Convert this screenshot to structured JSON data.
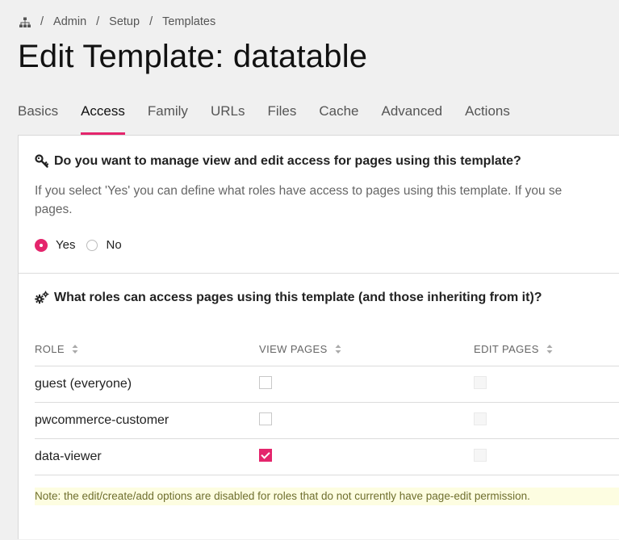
{
  "breadcrumb": {
    "home_icon": "sitemap-icon",
    "items": [
      "Admin",
      "Setup",
      "Templates"
    ],
    "separator": "/"
  },
  "page": {
    "title": "Edit Template: datatable"
  },
  "tabs": [
    {
      "label": "Basics",
      "active": false
    },
    {
      "label": "Access",
      "active": true
    },
    {
      "label": "Family",
      "active": false
    },
    {
      "label": "URLs",
      "active": false
    },
    {
      "label": "Files",
      "active": false
    },
    {
      "label": "Cache",
      "active": false
    },
    {
      "label": "Advanced",
      "active": false
    },
    {
      "label": "Actions",
      "active": false
    }
  ],
  "access_section": {
    "icon": "key-icon",
    "heading": "Do you want to manage view and edit access for pages using this template?",
    "description_line1": "If you select 'Yes' you can define what roles have access to pages using this template. If you se",
    "description_line2": "pages.",
    "options": [
      {
        "label": "Yes",
        "checked": true
      },
      {
        "label": "No",
        "checked": false
      }
    ]
  },
  "roles_section": {
    "icon": "gears-icon",
    "heading": "What roles can access pages using this template (and those inheriting from it)?",
    "columns": [
      "ROLE",
      "VIEW PAGES",
      "EDIT PAGES"
    ],
    "rows": [
      {
        "role": "guest (everyone)",
        "view": false,
        "edit_disabled": true
      },
      {
        "role": "pwcommerce-customer",
        "view": false,
        "edit_disabled": true
      },
      {
        "role": "data-viewer",
        "view": true,
        "edit_disabled": true
      }
    ],
    "note": "Note: the edit/create/add options are disabled for roles that do not currently have page-edit permission."
  },
  "colors": {
    "accent": "#e4256c",
    "note_bg": "#fdfde1",
    "note_text": "#6f6f2e"
  }
}
